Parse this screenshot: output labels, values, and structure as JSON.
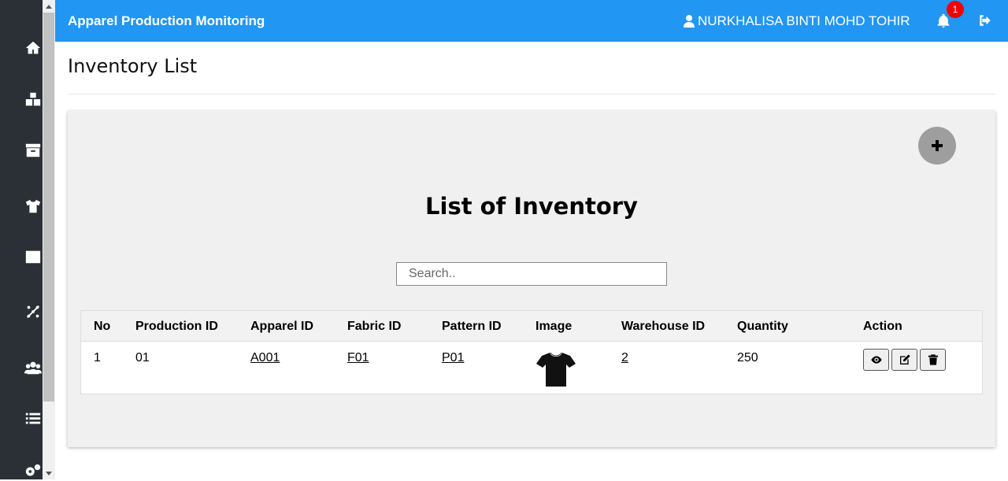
{
  "navbar": {
    "brand": "Apparel Production Monitoring",
    "user_name": "NURKHALISA BINTI MOHD TOHIR",
    "notification_count": "1"
  },
  "sidebar": {
    "items": [
      {
        "icon": "home-icon"
      },
      {
        "icon": "boxes-icon"
      },
      {
        "icon": "archive-icon"
      },
      {
        "icon": "tshirt-icon"
      },
      {
        "icon": "square-icon"
      },
      {
        "icon": "pattern-icon"
      },
      {
        "icon": "users-icon"
      },
      {
        "icon": "list-icon"
      },
      {
        "icon": "cogs-icon"
      }
    ]
  },
  "page": {
    "title": "Inventory List"
  },
  "card": {
    "title": "List of Inventory",
    "search_placeholder": "Search.."
  },
  "table": {
    "headers": [
      "No",
      "Production ID",
      "Apparel ID",
      "Fabric ID",
      "Pattern ID",
      "Image",
      "Warehouse ID",
      "Quantity",
      "Action"
    ],
    "rows": [
      {
        "no": "1",
        "production_id": "01",
        "apparel_id": "A001",
        "fabric_id": "F01",
        "pattern_id": "P01",
        "image": "black-tshirt",
        "warehouse_id": "2",
        "quantity": "250"
      }
    ]
  },
  "colors": {
    "navbar": "#2196f3",
    "sidebar": "#2b3036",
    "card": "#f0f0f0",
    "badge": "#f50000",
    "add_button": "#9e9e9e"
  }
}
